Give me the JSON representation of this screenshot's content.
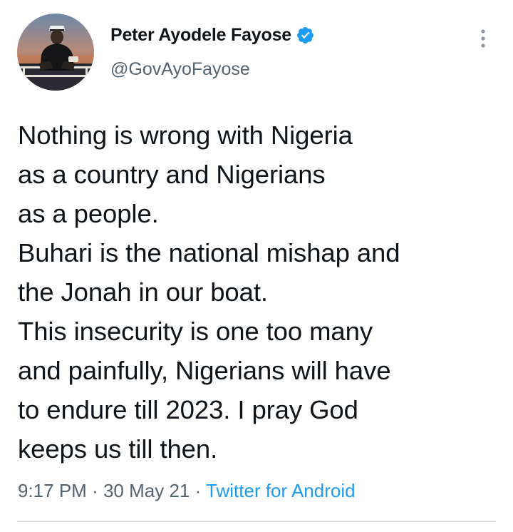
{
  "author": {
    "display_name": "Peter Ayodele Fayose",
    "handle": "@GovAyoFayose",
    "verified": true,
    "avatar_icon": "profile-photo",
    "verified_icon": "verified-badge-icon"
  },
  "tweet": {
    "text_lines": [
      "Nothing is wrong with Nigeria",
      "as a country and Nigerians",
      "as a people.",
      "Buhari is the national mishap and",
      "the Jonah in our boat.",
      "This insecurity is one too many",
      "and painfully, Nigerians will have",
      "to endure till 2023. I pray God",
      "keeps us till then."
    ],
    "time": "9:17 PM",
    "date": "30 May 21",
    "separator": "·",
    "source": "Twitter for Android"
  },
  "colors": {
    "text": "#0f1419",
    "secondary": "#536471",
    "accent": "#1d9bf0",
    "divider": "#cfd9de"
  },
  "more_icon": "more-vertical-icon"
}
